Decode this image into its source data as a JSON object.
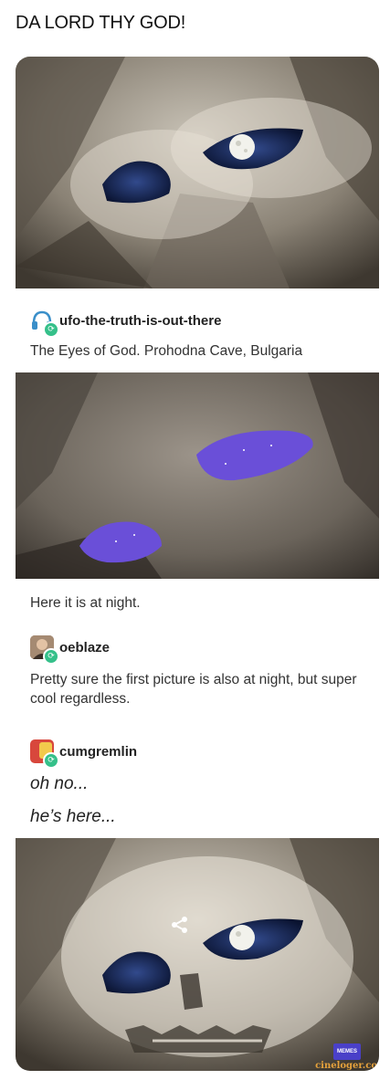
{
  "title": "DA LORD THY GOD!",
  "posts": [
    {
      "username": "ufo-the-truth-is-out-there",
      "text": "The Eyes of God. Prohodna Cave, Bulgaria",
      "avatar_icon": "headphones-avatar-icon"
    },
    {
      "text": "Here it is at night."
    },
    {
      "username": "oeblaze",
      "text": "Pretty sure the first picture is also at night, but super cool regardless.",
      "avatar_icon": "person-avatar-icon"
    },
    {
      "username": "cumgremlin",
      "lines": [
        "oh no...",
        "he’s here..."
      ],
      "avatar_icon": "sticker-avatar-icon"
    }
  ],
  "watermark": {
    "badge": "MEMES",
    "site": "cineloger.co"
  },
  "colors": {
    "reblog": "#35c08a",
    "night_sky": "#6a4fd8",
    "watermark": "#4a40c8"
  }
}
